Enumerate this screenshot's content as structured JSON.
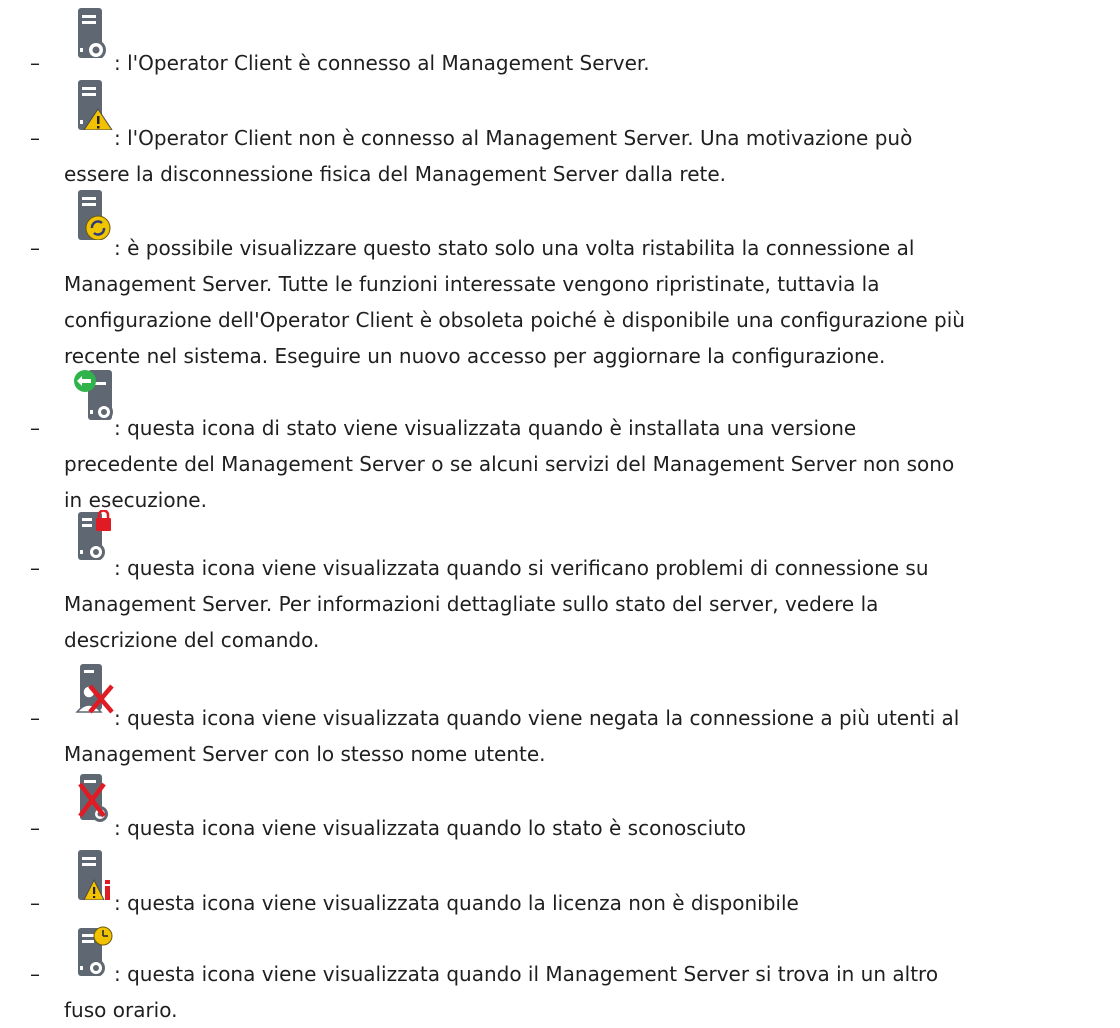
{
  "bullet": "–",
  "items": [
    {
      "icon": "server-connected-icon",
      "text": ": l'Operator Client è connesso al Management Server."
    },
    {
      "icon": "server-warning-icon",
      "text": ": l'Operator Client non è connesso al Management Server. Una motivazione può\nessere la disconnessione fisica del Management Server dalla rete."
    },
    {
      "icon": "server-reconnect-icon",
      "text": ": è possibile visualizzare questo stato solo una volta ristabilita la connessione al\nManagement Server. Tutte le funzioni interessate vengono ripristinate, tuttavia la\nconfigurazione dell'Operator Client è obsoleta poiché è disponibile una configurazione più\nrecente nel sistema. Eseguire un nuovo accesso per aggiornare la configurazione."
    },
    {
      "icon": "server-older-version-icon",
      "text": ": questa icona di stato viene visualizzata quando è installata una versione\nprecedente del Management Server o se alcuni servizi del Management Server non sono\nin esecuzione."
    },
    {
      "icon": "server-lock-icon",
      "text": ": questa icona viene visualizzata quando si verificano problemi di connessione su\nManagement Server. Per informazioni dettagliate sullo stato del server, vedere la\ndescrizione del comando."
    },
    {
      "icon": "user-denied-icon",
      "text": ": questa icona viene visualizzata quando viene negata la connessione a più utenti al\nManagement Server con lo stesso nome utente."
    },
    {
      "icon": "server-unknown-icon",
      "text": ": questa icona viene visualizzata quando lo stato è sconosciuto"
    },
    {
      "icon": "server-license-icon",
      "text": ": questa icona viene visualizzata quando la licenza non è disponibile"
    },
    {
      "icon": "server-timezone-icon",
      "text": ": questa icona viene visualizzata quando il Management Server si trova in un altro\nfuso orario."
    }
  ]
}
